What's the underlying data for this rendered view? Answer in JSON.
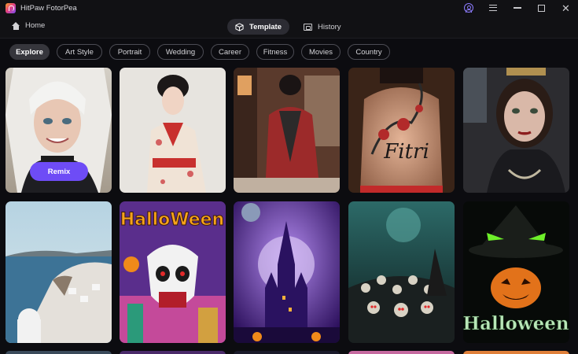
{
  "app": {
    "title": "HitPaw FotorPea"
  },
  "nav": {
    "home_label": "Home",
    "tabs": [
      {
        "label": "Template"
      },
      {
        "label": "History"
      }
    ]
  },
  "categories": [
    "Explore",
    "Art Style",
    "Portrait",
    "Wedding",
    "Career",
    "Fitness",
    "Movies",
    "Country"
  ],
  "selected_category": "Explore",
  "cards": {
    "remix_label": "Remix",
    "row1": [
      "Anime portrait with white hair",
      "Woman in floral kimono",
      "Woman in red kimono with back tattoo",
      "Back tattoo",
      "Gothic portrait woman"
    ],
    "row2": [
      "Coastal village view",
      "Halloween skull poster",
      "Purple haunted castle",
      "Skeleton army in graveyard",
      "Witch pumpkin"
    ],
    "halloween_text_1": "HalloWeen",
    "tattoo_text": "Fitri",
    "halloween_text_2": "Halloween"
  },
  "colors": {
    "accent": "#6e4cf6",
    "background": "#0c0c10",
    "chip_border": "#4c4c54"
  }
}
